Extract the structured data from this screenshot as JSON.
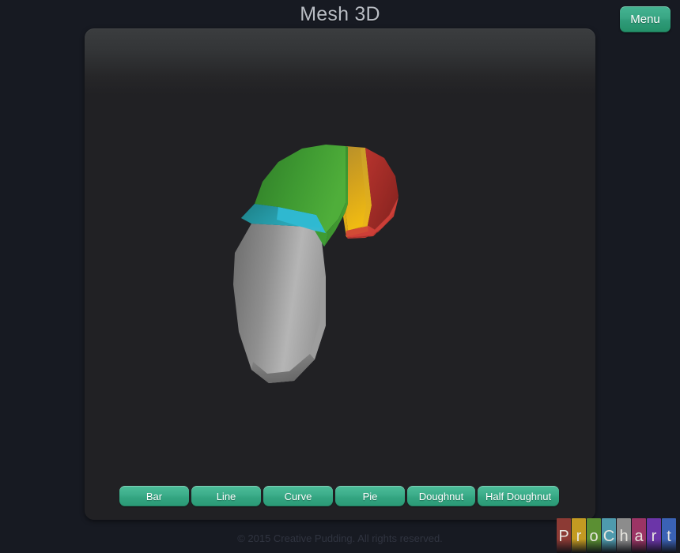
{
  "header": {
    "title": "Mesh 3D",
    "menu_label": "Menu"
  },
  "toolbar": {
    "buttons": [
      {
        "label": "Bar",
        "name": "chart-type-bar"
      },
      {
        "label": "Line",
        "name": "chart-type-line"
      },
      {
        "label": "Curve",
        "name": "chart-type-curve"
      },
      {
        "label": "Pie",
        "name": "chart-type-pie"
      },
      {
        "label": "Doughnut",
        "name": "chart-type-doughnut"
      },
      {
        "label": "Half Doughnut",
        "name": "chart-type-half-doughnut"
      }
    ]
  },
  "footer": {
    "copyright": "© 2015 Creative Pudding. All rights reserved."
  },
  "logo": {
    "name": "ProChart",
    "letters": [
      {
        "char": "P",
        "color": "#8c3a34"
      },
      {
        "char": "r",
        "color": "#c39a22"
      },
      {
        "char": "o",
        "color": "#5b8f33"
      },
      {
        "char": "C",
        "color": "#4e9aad"
      },
      {
        "char": "h",
        "color": "#8c8c8c"
      },
      {
        "char": "a",
        "color": "#9c3465"
      },
      {
        "char": "r",
        "color": "#6b35a8"
      },
      {
        "char": "t",
        "color": "#3a62b5"
      }
    ]
  },
  "colors": {
    "page_background": "#171a22",
    "panel_background": "#212124",
    "accent_green": "#33a480",
    "title_text": "#b9bdc4",
    "footer_text": "#303440"
  },
  "chart_data": {
    "type": "pie",
    "title": "Mesh 3D",
    "variant": "half-doughnut-3d-exploded",
    "xlabel": "",
    "ylabel": "",
    "legend": "none",
    "grid": false,
    "categories": [
      "Green",
      "Gold",
      "Red",
      "Teal",
      "Gray"
    ],
    "values": [
      34,
      10,
      16,
      7,
      33
    ],
    "colors": [
      "#3d9a33",
      "#e3a817",
      "#cc3b33",
      "#17a3bd",
      "#a8a8a8"
    ],
    "slices": [
      {
        "label": "Green",
        "value": 34,
        "color": "#3d9a33",
        "exploded": false
      },
      {
        "label": "Gold",
        "value": 10,
        "color": "#e3a817",
        "exploded": true
      },
      {
        "label": "Red",
        "value": 16,
        "color": "#cc3b33",
        "exploded": true
      },
      {
        "label": "Teal",
        "value": 7,
        "color": "#17a3bd",
        "exploded": false
      },
      {
        "label": "Gray",
        "value": 33,
        "color": "#a8a8a8",
        "exploded": false
      }
    ]
  }
}
